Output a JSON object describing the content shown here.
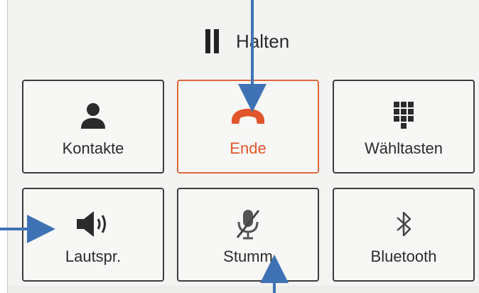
{
  "hold": {
    "label": "Halten",
    "icon": "pause-icon"
  },
  "buttons": [
    {
      "label": "Kontakte",
      "icon": "person-icon"
    },
    {
      "label": "Ende",
      "icon": "hang-up-phone-icon"
    },
    {
      "label": "Wähltasten",
      "icon": "dialpad-icon"
    },
    {
      "label": "Lautspr.",
      "icon": "speaker-icon"
    },
    {
      "label": "Stumm",
      "icon": "mic-muted-icon"
    },
    {
      "label": "Bluetooth",
      "icon": "bluetooth-icon"
    }
  ],
  "colors": {
    "end_accent": "#e0552b",
    "annotation_arrow": "#3f72b5",
    "button_border": "#3c3c3c"
  }
}
